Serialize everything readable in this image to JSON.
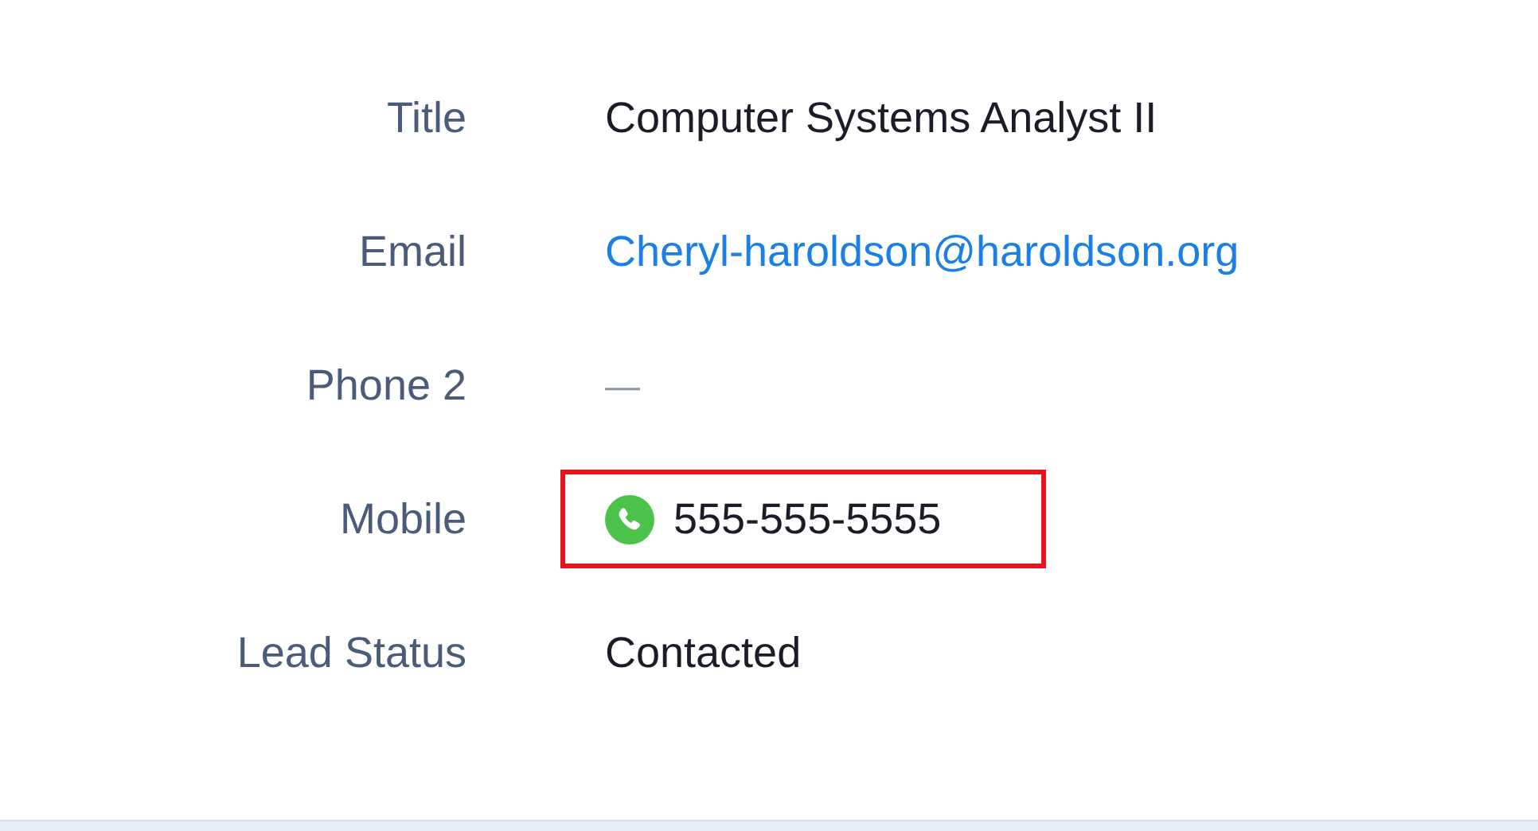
{
  "fields": [
    {
      "label": "Title",
      "kind": "text",
      "value": "Computer Systems Analyst II",
      "highlighted": false
    },
    {
      "label": "Email",
      "kind": "link",
      "value": "Cheryl-haroldson@haroldson.org",
      "highlighted": false
    },
    {
      "label": "Phone 2",
      "kind": "empty",
      "value": "—",
      "highlighted": false
    },
    {
      "label": "Mobile",
      "kind": "phone",
      "value": "555-555-5555",
      "highlighted": true
    },
    {
      "label": "Lead Status",
      "kind": "text",
      "value": "Contacted",
      "highlighted": false
    }
  ]
}
